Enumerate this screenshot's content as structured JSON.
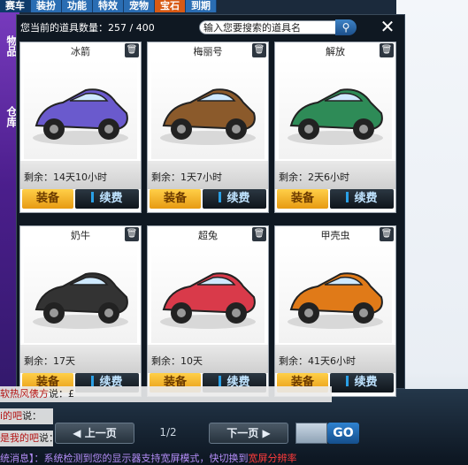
{
  "tabs": [
    "赛车",
    "装扮",
    "功能",
    "特效",
    "宠物",
    "宝石",
    "到期"
  ],
  "side_tabs": [
    "物品",
    "仓库"
  ],
  "header": {
    "count_label": "您当前的道具数量：",
    "count_value": "257 / 400",
    "search_placeholder": "输入您要搜索的道具名",
    "close_icon": "close-icon"
  },
  "cards": [
    {
      "name": "冰箭",
      "remain": "剩余：14天10小时",
      "equip": "装备",
      "renew": "续费",
      "color": "#6a5acd"
    },
    {
      "name": "梅丽号",
      "remain": "剩余：1天7小时",
      "equip": "装备",
      "renew": "续费",
      "color": "#8b5a2b"
    },
    {
      "name": "解放",
      "remain": "剩余：2天6小时",
      "equip": "装备",
      "renew": "续费",
      "color": "#2e8b57"
    },
    {
      "name": "奶牛",
      "remain": "剩余：17天",
      "equip": "装备",
      "renew": "续费",
      "color": "#333333"
    },
    {
      "name": "超兔",
      "remain": "剩余：10天",
      "equip": "装备",
      "renew": "续费",
      "color": "#d93a4a"
    },
    {
      "name": "甲壳虫",
      "remain": "剩余：41天6小时",
      "equip": "装备",
      "renew": "续费",
      "color": "#e07a18"
    }
  ],
  "chat": [
    {
      "name": "软热风俵方",
      "text": "说：£"
    },
    {
      "name": "i的吧",
      "text": "说："
    },
    {
      "name": "是我的吧",
      "text": "说："
    }
  ],
  "pager": {
    "prev": "上一页",
    "page": "1/2",
    "next": "下一页",
    "go": "GO"
  },
  "system_message": {
    "prefix": "统消息】：系统检测到您的显示器支持宽屏模式，快切换到",
    "highlight": "宽屏分辨率"
  }
}
